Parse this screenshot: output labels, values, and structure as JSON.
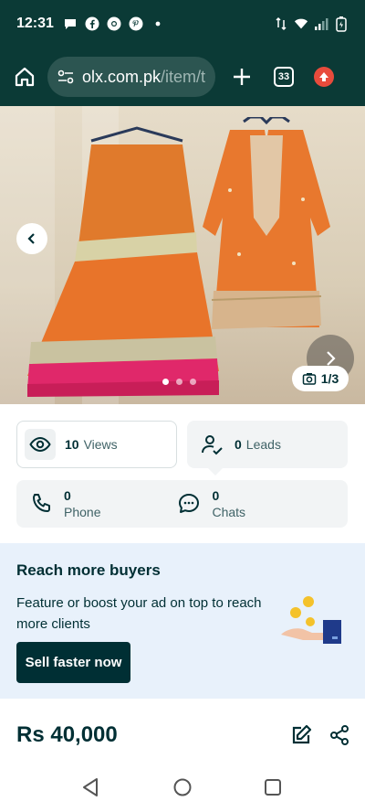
{
  "status_bar": {
    "time": "12:31"
  },
  "browser": {
    "url_host": "olx.com.pk",
    "url_path": "/item/t",
    "tab_count": "33"
  },
  "gallery": {
    "counter": "1/3",
    "dot_count": 3,
    "active_dot": 1
  },
  "stats": {
    "views_count": "10",
    "views_label": "Views",
    "leads_count": "0",
    "leads_label": "Leads",
    "phone_count": "0",
    "phone_label": "Phone",
    "chats_count": "0",
    "chats_label": "Chats"
  },
  "promo": {
    "title": "Reach more buyers",
    "text": "Feature or boost your ad on top to reach more clients",
    "button_label": "Sell faster now"
  },
  "listing": {
    "price": "Rs 40,000"
  },
  "colors": {
    "status_bar_bg": "#0b3a36",
    "primary_dark": "#002f34",
    "promo_bg": "#e8f1fb",
    "dress_orange": "#e8742a",
    "dress_pink": "#e0286a"
  },
  "icons": {
    "status": [
      "message-icon",
      "facebook-icon",
      "chrome-icon",
      "pinterest-icon",
      "dot-icon"
    ],
    "status_right": [
      "data-arrows-icon",
      "wifi-icon",
      "signal-icon",
      "battery-icon"
    ]
  }
}
